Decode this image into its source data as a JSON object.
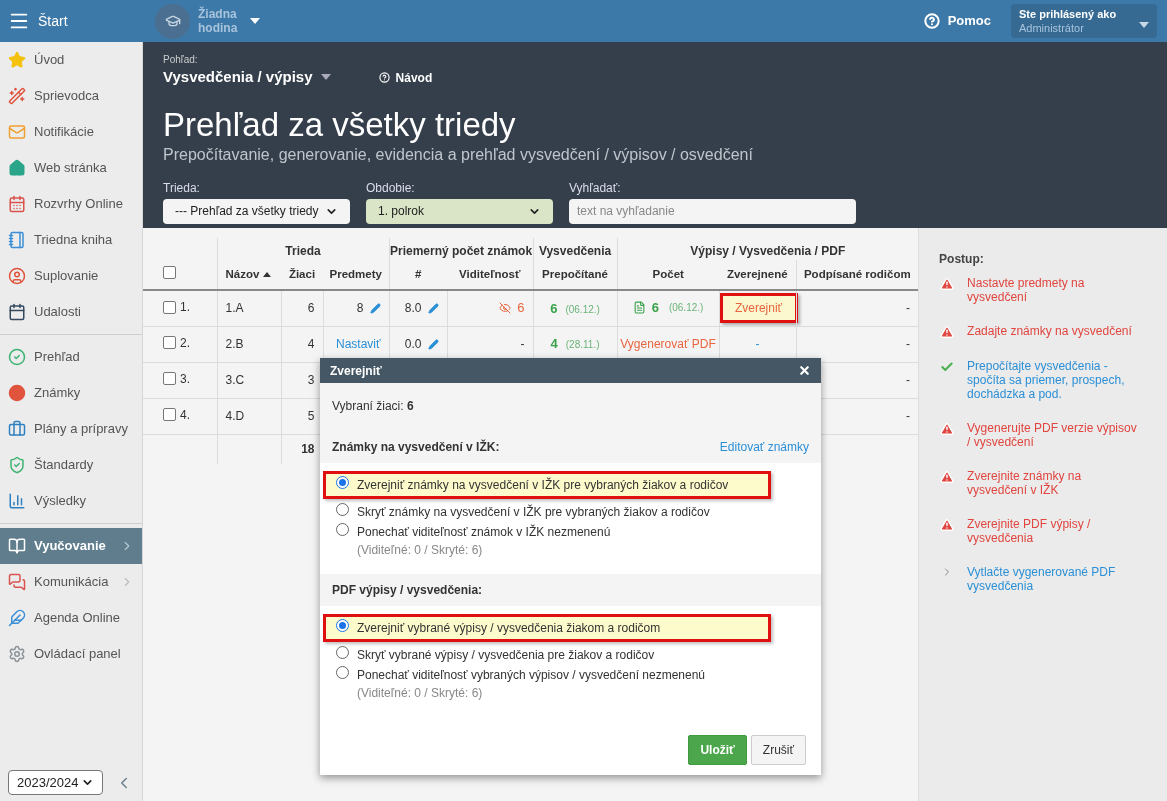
{
  "topbar": {
    "start_label": "Štart",
    "lesson": "Žiadna hodina",
    "help": "Pomoc",
    "user_caption": "Ste prihlásený ako",
    "user_name": "Administrátor"
  },
  "sidebar": {
    "groups": [
      [
        {
          "label": "Úvod",
          "selected": false,
          "submenu": false
        },
        {
          "label": "Sprievodca",
          "selected": false,
          "submenu": false
        },
        {
          "label": "Notifikácie",
          "selected": false,
          "submenu": false
        },
        {
          "label": "Web stránka",
          "selected": false,
          "submenu": false
        },
        {
          "label": "Rozvrhy Online",
          "selected": false,
          "submenu": false
        },
        {
          "label": "Triedna kniha",
          "selected": false,
          "submenu": false
        },
        {
          "label": "Suplovanie",
          "selected": false,
          "submenu": false
        },
        {
          "label": "Udalosti",
          "selected": false,
          "submenu": false
        }
      ],
      [
        {
          "label": "Prehľad",
          "selected": false,
          "submenu": false
        },
        {
          "label": "Známky",
          "selected": false,
          "submenu": false
        },
        {
          "label": "Plány a prípravy",
          "selected": false,
          "submenu": false
        },
        {
          "label": "Štandardy",
          "selected": false,
          "submenu": false
        },
        {
          "label": "Výsledky",
          "selected": false,
          "submenu": false
        }
      ],
      [
        {
          "label": "Vyučovanie",
          "selected": true,
          "submenu": true
        },
        {
          "label": "Komunikácia",
          "selected": false,
          "submenu": true
        },
        {
          "label": "Agenda Online",
          "selected": false,
          "submenu": false
        },
        {
          "label": "Ovládací panel",
          "selected": false,
          "submenu": false
        }
      ]
    ],
    "year": "2023/2024"
  },
  "header": {
    "view_label": "Pohľad:",
    "view": "Vysvedčenia / výpisy",
    "guide": "Návod",
    "title": "Prehľad za všetky triedy",
    "subtitle": "Prepočítavanie, generovanie, evidencia a prehľad vysvedčení / výpisov / osvedčení",
    "filters": [
      {
        "kind": "select",
        "label": "Trieda:",
        "value": "--- Prehľad za všetky triedy",
        "highlighted": false
      },
      {
        "kind": "select",
        "label": "Obdobie:",
        "value": "1. polrok",
        "highlighted": true
      },
      {
        "kind": "input",
        "label": "Vyhľadať:",
        "placeholder": "text na vyhľadanie"
      }
    ]
  },
  "table": {
    "groups": [
      "Trieda",
      "Priemerný počet známok",
      "Vysvedčenia",
      "Výpisy / Vysvedčenia / PDF"
    ],
    "select_all": false,
    "columns": [
      {
        "label": "Názov",
        "sorted": true
      },
      {
        "label": "Žiaci",
        "sorted": false
      },
      {
        "label": "Predmety",
        "sorted": false
      },
      {
        "label": "#",
        "sorted": false
      },
      {
        "label": "Viditeľnosť",
        "sorted": false
      },
      {
        "label": "Prepočítané",
        "sorted": false
      },
      {
        "label": "Počet",
        "sorted": false
      },
      {
        "label": "Zverejnené",
        "sorted": false
      },
      {
        "label": "Podpísané rodičom",
        "sorted": false
      }
    ],
    "rows": [
      {
        "checked": false,
        "number": "1.",
        "name": "1.A",
        "students": "6",
        "subjects": {
          "kind": "value",
          "text": "8"
        },
        "average": "8.0",
        "visibility": {
          "kind": "hidden",
          "text": "6"
        },
        "recalculated": {
          "count": "6",
          "date": "(06.12.)"
        },
        "pdf": {
          "kind": "file",
          "text": "6",
          "date": "(06.12.)"
        },
        "published": {
          "kind": "action",
          "text": "Zverejniť",
          "highlighted": true
        },
        "signed": "-"
      },
      {
        "checked": false,
        "number": "2.",
        "name": "2.B",
        "students": "4",
        "subjects": {
          "kind": "link",
          "text": "Nastaviť"
        },
        "average": "0.0",
        "visibility": {
          "kind": "plain",
          "text": "-"
        },
        "recalculated": {
          "count": "4",
          "date": "(28.11.)"
        },
        "pdf": {
          "kind": "action",
          "text": "Vygenerovať PDF"
        },
        "published": {
          "kind": "link",
          "text": "-",
          "highlighted": false
        },
        "signed": "-"
      },
      {
        "checked": false,
        "number": "3.",
        "name": "3.C",
        "students": "3",
        "signed": "-"
      },
      {
        "checked": false,
        "number": "4.",
        "name": "4.D",
        "students": "5",
        "signed": "-"
      }
    ],
    "total_students": "18"
  },
  "steps": {
    "title": "Postup:",
    "items": [
      {
        "kind": "warning",
        "text": "Nastavte predmety na vysvedčení"
      },
      {
        "kind": "warning",
        "text": "Zadajte známky na vysvedčení"
      },
      {
        "kind": "done",
        "text": "Prepočítajte vysvedčenia - spočíta sa priemer, prospech, dochádzka a pod."
      },
      {
        "kind": "warning",
        "text": "Vygenerujte PDF verzie výpisov / vysvedčení"
      },
      {
        "kind": "warning",
        "text": "Zverejnite známky na vysvedčení v IŽK"
      },
      {
        "kind": "warning",
        "text": "Zverejnite PDF výpisy / vysvedčenia"
      },
      {
        "kind": "next",
        "text": "Vytlačte vygenerované PDF vysvedčenia"
      }
    ]
  },
  "modal": {
    "title": "Zverejniť",
    "selected_students": "Vybraní žiaci: **6**",
    "sections": [
      {
        "title": "Známky na vysvedčení v IŽK:",
        "link": "Editovať známky",
        "options": [
          {
            "label": "Zverejniť známky na vysvedčení v IŽK pre vybraných žiakov a rodičov",
            "selected": true,
            "highlighted": true
          },
          {
            "label": "Skryť známky na vysvedčení v IŽK pre vybraných žiakov a rodičov",
            "selected": false,
            "highlighted": false
          },
          {
            "label": "Ponechať viditeľnosť známok v IŽK nezmenenú",
            "note": "(Viditeľné: 0 / Skryté: 6)",
            "selected": false,
            "highlighted": false
          }
        ]
      },
      {
        "title": "PDF výpisy / vysvedčenia:",
        "options": [
          {
            "label": "Zverejniť vybrané výpisy / vysvedčenia žiakom a rodičom",
            "selected": true,
            "highlighted": true
          },
          {
            "label": "Skryť vybrané výpisy / vysvedčenia pre žiakov a rodičov",
            "selected": false,
            "highlighted": false
          },
          {
            "label": "Ponechať viditeľnosť vybraných výpisov / vysvedčení nezmenenú",
            "note": "(Viditeľné: 0 / Skryté: 6)",
            "selected": false,
            "highlighted": false
          }
        ]
      }
    ],
    "buttons": [
      {
        "kind": "primary",
        "label": "Uložiť"
      },
      {
        "kind": "secondary",
        "label": "Zrušiť"
      }
    ]
  }
}
